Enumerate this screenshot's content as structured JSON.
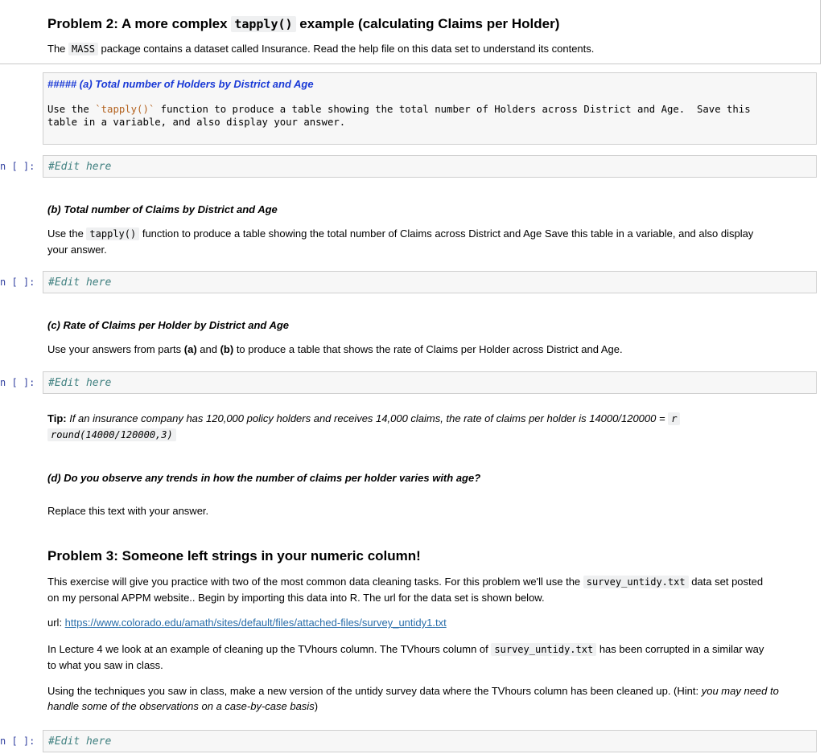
{
  "problem2": {
    "title_pre": "Problem 2: A more complex ",
    "title_code": "tapply()",
    "title_post": " example (calculating Claims per Holder)",
    "intro_pre": "The ",
    "intro_code": "MASS",
    "intro_post": " package contains a dataset called Insurance. Read the help file on this data set to understand its contents."
  },
  "part_a": {
    "heading": "##### (a) Total number of Holders by District and Age",
    "line1_pre": "Use the ",
    "line1_code": "`tapply()`",
    "line1_post": " function to produce a table showing the total number of Holders across District and Age.  Save this",
    "line2": "table in a variable, and also display your answer."
  },
  "code_cells": [
    {
      "prompt": "n [ ]:",
      "text": "#Edit here"
    },
    {
      "prompt": "n [ ]:",
      "text": "#Edit here"
    },
    {
      "prompt": "n [ ]:",
      "text": "#Edit here"
    },
    {
      "prompt": "n [ ]:",
      "text": "#Edit here"
    }
  ],
  "part_b": {
    "heading": "(b) Total number of Claims by District and Age",
    "text_pre": "Use the ",
    "text_code": "tapply()",
    "text_post": " function to produce a table showing the total number of Claims across District and Age Save this table in a variable, and also display",
    "text_line2": "your answer."
  },
  "part_c": {
    "heading": "(c) Rate of Claims per Holder by District and Age",
    "text_pre": "Use your answers from parts ",
    "text_a": "(a)",
    "text_mid": " and ",
    "text_b": "(b)",
    "text_post": " to produce a table that shows the rate of Claims per Holder across District and Age."
  },
  "tip": {
    "label": "Tip:",
    "text": " If an insurance company has 120,000 policy holders and receives 14,000 claims, the rate of claims per holder is 14000/120000 = ",
    "code1": "r",
    "code2": "round(14000/120000,3)"
  },
  "part_d": {
    "heading": "(d) Do you observe any trends in how the number of claims per holder varies with age?",
    "answer": "Replace this text with your answer."
  },
  "problem3": {
    "title": "Problem 3: Someone left strings in your numeric column!",
    "p1_pre": "This exercise will give you practice with two of the most common data cleaning tasks. For this problem we'll use the ",
    "p1_code": "survey_untidy.txt",
    "p1_post": " data set posted",
    "p1_line2": "on my personal APPM website.. Begin by importing this data into R. The url for the data set is shown below.",
    "url_label": "url: ",
    "url": "https://www.colorado.edu/amath/sites/default/files/attached-files/survey_untidy1.txt",
    "p2_pre": "In Lecture 4 we look at an example of cleaning up the TVhours column. The TVhours column of ",
    "p2_code": "survey_untidy.txt",
    "p2_post": " has been corrupted in a similar way",
    "p2_line2": "to what you saw in class.",
    "p3_line1_pre": "Using the techniques you saw in class, make a new version of the untidy survey data where the TVhours column has been cleaned up. (Hint: ",
    "p3_line1_em": "you may need to",
    "p3_line2_em": "handle some of the observations on a case-by-case basis",
    "p3_line2_post": ")"
  }
}
